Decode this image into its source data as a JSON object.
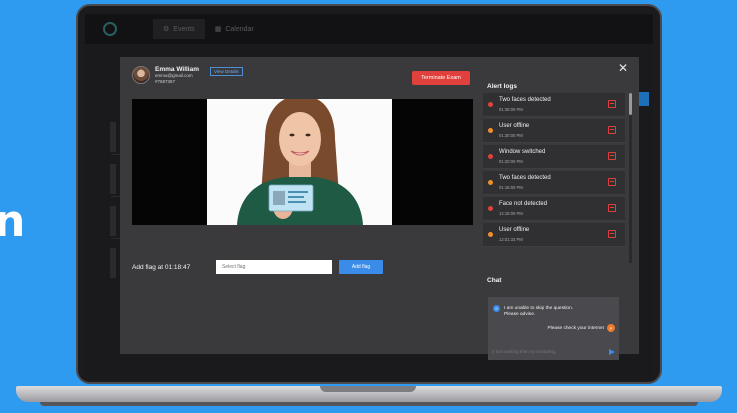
{
  "backdrop": {
    "partial_letter": "n"
  },
  "app": {
    "tabs": [
      {
        "label": "Events",
        "icon": "gear-icon"
      },
      {
        "label": "Calendar",
        "icon": "calendar-icon"
      }
    ]
  },
  "modal": {
    "user": {
      "name": "Emma William",
      "email": "emma@gmail.com",
      "id": "#7687367",
      "view_details_label": "View Details"
    },
    "terminate_label": "Terminate Exam",
    "close_icon": "close-icon",
    "flag": {
      "label": "Add flag at 01:18:47",
      "placeholder": "Select flag",
      "button_label": "Add flag"
    },
    "alert_logs": {
      "title": "Alert logs",
      "items": [
        {
          "text": "Two faces detected",
          "time": "01:38:00 PM",
          "color": "#e0413c"
        },
        {
          "text": "User offline",
          "time": "01:30:00 PM",
          "color": "#f0902a"
        },
        {
          "text": "Window switched",
          "time": "01:20:00 PM",
          "color": "#e0413c"
        },
        {
          "text": "Two faces detected",
          "time": "01:16:00 PM",
          "color": "#f0902a"
        },
        {
          "text": "Face not detected",
          "time": "12:15:00 PM",
          "color": "#e0413c"
        },
        {
          "text": "User offline",
          "time": "12:01:33 PM",
          "color": "#f0902a"
        }
      ]
    },
    "chat": {
      "title": "Chat",
      "incoming": {
        "avatar": "S",
        "line1": "I am unable to skip the question.",
        "line2": "Please advise."
      },
      "outgoing": {
        "avatar": "P",
        "text": "Please check your internet"
      },
      "input_placeholder": "If not working then try restarting."
    }
  },
  "colors": {
    "accent": "#3a8ce8",
    "danger": "#e0413c",
    "warning": "#f0902a",
    "page_background": "#2f9bf0"
  }
}
